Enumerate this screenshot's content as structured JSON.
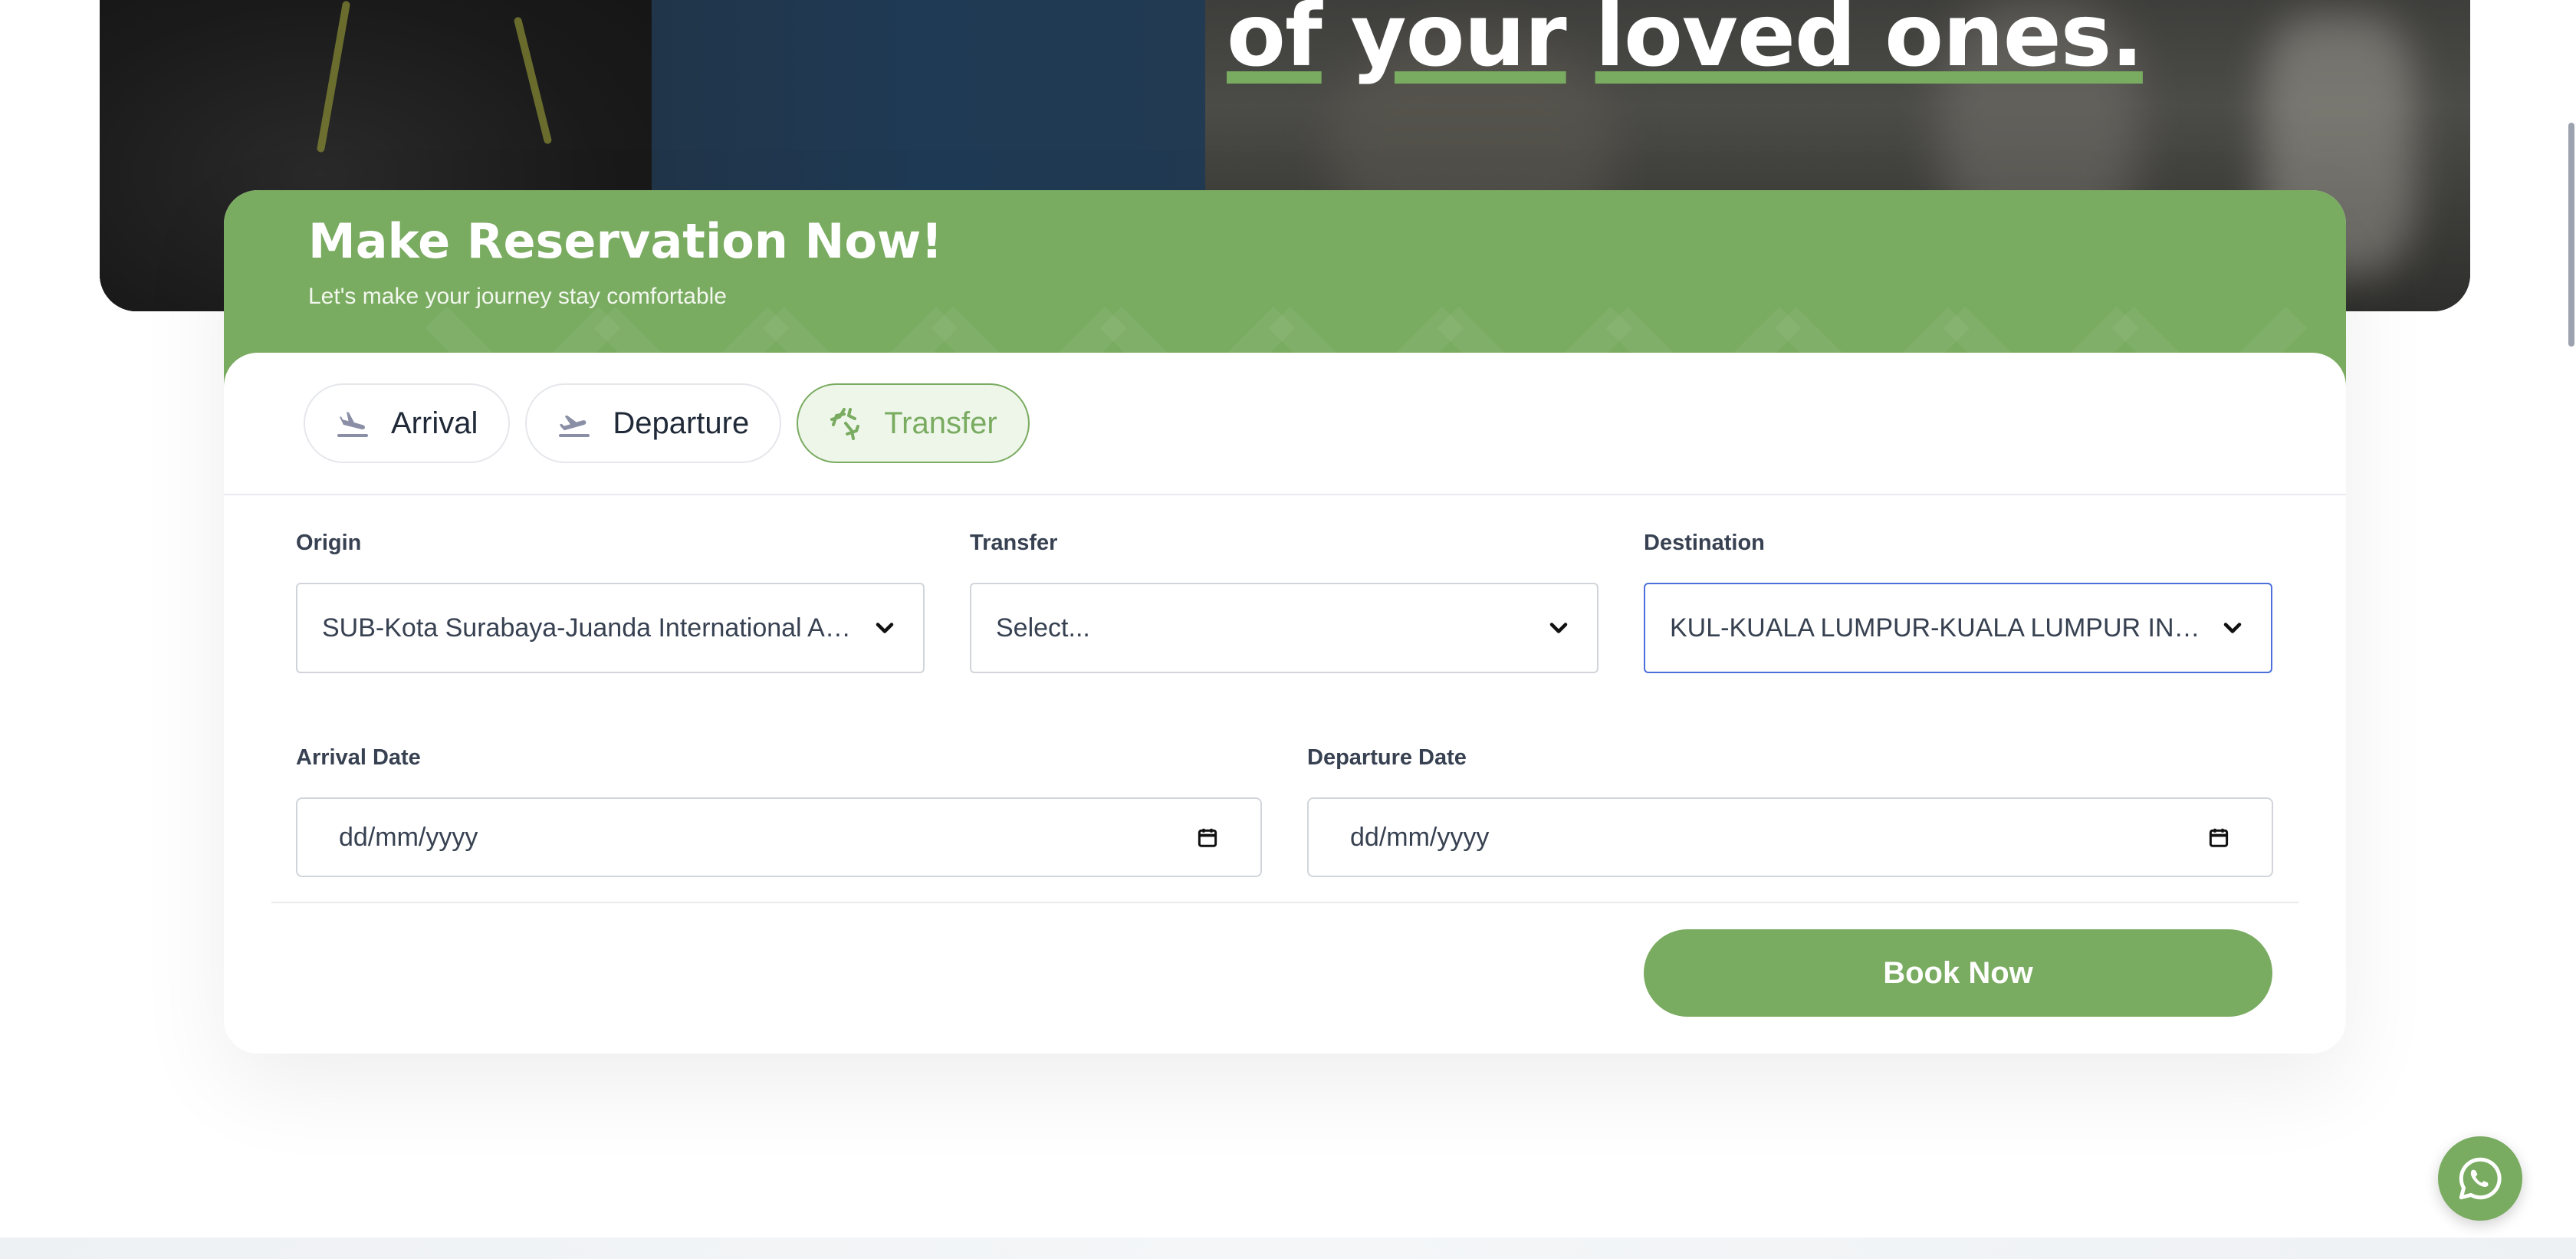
{
  "hero": {
    "heading_prefix": "of",
    "heading_mid": "your",
    "heading_end": "loved ones."
  },
  "reservation": {
    "title": "Make Reservation Now!",
    "subtitle": "Let's make your journey stay comfortable",
    "tabs": [
      {
        "label": "Arrival",
        "icon": "plane-landing-icon",
        "active": false
      },
      {
        "label": "Departure",
        "icon": "plane-takeoff-icon",
        "active": false
      },
      {
        "label": "Transfer",
        "icon": "plane-transfer-icon",
        "active": true
      }
    ],
    "fields": {
      "origin": {
        "label": "Origin",
        "value": "SUB-Kota Surabaya-Juanda International Airport"
      },
      "transfer": {
        "label": "Transfer",
        "value": "Select..."
      },
      "destination": {
        "label": "Destination",
        "value": "KUL-KUALA LUMPUR-KUALA LUMPUR INTERNATIONAL AIRPORT"
      },
      "arrival_date": {
        "label": "Arrival Date",
        "placeholder": "dd/mm/yyyy"
      },
      "departure_date": {
        "label": "Departure Date",
        "placeholder": "dd/mm/yyyy"
      }
    },
    "book_button": "Book Now"
  },
  "colors": {
    "accent": "#79ab60",
    "focus": "#4c6fdc"
  }
}
